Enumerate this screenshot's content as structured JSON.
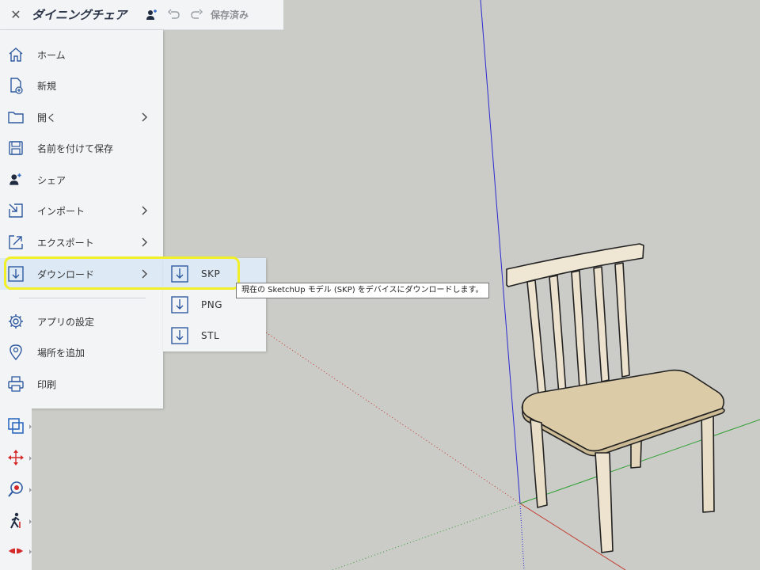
{
  "titlebar": {
    "close_icon": "close-icon",
    "title": "ダイニングチェア",
    "share_icon": "share-user-icon",
    "undo_icon": "undo-icon",
    "redo_icon": "redo-icon",
    "status": "保存済み"
  },
  "menu": {
    "items": [
      {
        "label": "ホーム",
        "icon": "home-icon"
      },
      {
        "label": "新規",
        "icon": "new-file-icon"
      },
      {
        "label": "開く",
        "icon": "folder-icon",
        "has_submenu": true
      },
      {
        "label": "名前を付けて保存",
        "icon": "save-icon"
      },
      {
        "label": "シェア",
        "icon": "share-user-icon"
      },
      {
        "label": "インポート",
        "icon": "import-icon",
        "has_submenu": true
      },
      {
        "label": "エクスポート",
        "icon": "export-icon",
        "has_submenu": true
      },
      {
        "label": "ダウンロード",
        "icon": "download-icon",
        "has_submenu": true,
        "active": true
      },
      {
        "label": "アプリの設定",
        "icon": "gear-icon"
      },
      {
        "label": "場所を追加",
        "icon": "location-pin-icon"
      },
      {
        "label": "印刷",
        "icon": "printer-icon"
      }
    ]
  },
  "download_submenu": {
    "items": [
      {
        "label": "SKP",
        "icon": "download-icon",
        "active": true
      },
      {
        "label": "PNG",
        "icon": "download-icon"
      },
      {
        "label": "STL",
        "icon": "download-icon"
      }
    ]
  },
  "tooltip": {
    "text": "現在の SketchUp モデル (SKP) をデバイスにダウンロードします。"
  },
  "toolbar": {
    "tools": [
      {
        "name": "select-window-tool",
        "icon": "select-rectangle-icon"
      },
      {
        "name": "move-tool",
        "icon": "move-arrows-icon"
      },
      {
        "name": "look-around-tool",
        "icon": "eye-target-icon"
      },
      {
        "name": "walk-tool",
        "icon": "walk-icon"
      },
      {
        "name": "section-plane-tool",
        "icon": "section-plane-icon"
      }
    ]
  },
  "colors": {
    "canvas_background": "#cbcbc8",
    "panel_background": "#f3f4f6",
    "active_item": "#dde9f5",
    "highlight_border": "#f0ef2a",
    "icon_blue": "#2f5aa0",
    "axis_blue": "#2a2ad0",
    "axis_red": "#c0392b",
    "axis_green": "#2fa02f",
    "chair_wood": "#e8ddc6"
  }
}
